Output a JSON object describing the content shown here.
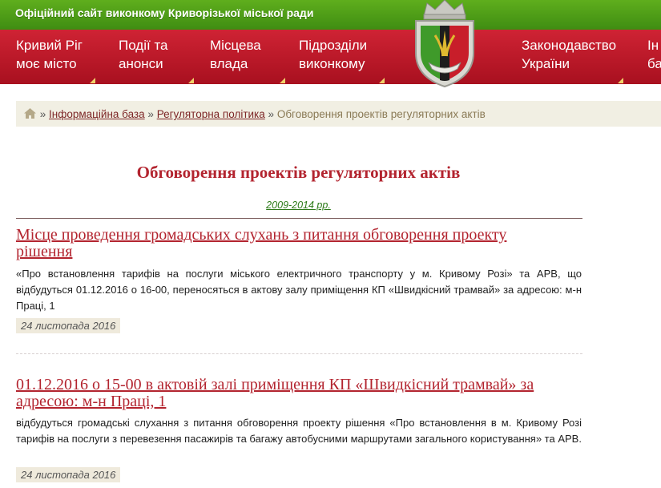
{
  "header": {
    "site_title": "Офіційний сайт виконкому Криворізької міської ради"
  },
  "nav": {
    "items": [
      {
        "line1": "Кривий Ріг",
        "line2": "моє місто"
      },
      {
        "line1": "Події та",
        "line2": "анонси"
      },
      {
        "line1": "Місцева",
        "line2": "влада"
      },
      {
        "line1": "Підрозділи",
        "line2": "виконкому"
      },
      {
        "line1": "Законодавство",
        "line2": "України"
      },
      {
        "line1": "Ін",
        "line2": "ба"
      }
    ],
    "emblem": "city-coat-of-arms",
    "colors": {
      "top_bar": "#4f9e18",
      "nav_bar": "#c01a2a",
      "accent_corner": "#f0d36a"
    }
  },
  "breadcrumb": {
    "home_icon": "home-icon",
    "separator": "»",
    "items": [
      {
        "label": "Інформаційна база"
      },
      {
        "label": "Регуляторна політика"
      }
    ],
    "current": "Обговорення проектів регуляторних актів"
  },
  "main": {
    "title": "Обговорення проектів регуляторних актів",
    "years_link": "2009-2014 рр.",
    "news": [
      {
        "title_line1": "Місце проведення громадських слухань з питання обговорення проекту",
        "title_line2": "рішення",
        "body": "«Про встановлення тарифів на послуги міського електричного транспорту у м. Кривому Розі» та АРВ, що відбудуться 01.12.2016 о 16-00, переносяться в актову залу приміщення КП «Швидкісний трамвай» за адресою: м-н Праці, 1",
        "date": "24 листопада 2016"
      },
      {
        "title_line1": "01.12.2016 о 15-00 в актовій залі приміщення КП «Швидкісний трамвай» за",
        "title_line2": "адресою: м-н Праці, 1",
        "body": "відбудуться громадські слухання з питання обговорення проекту рішення «Про встановлення в м. Кривому Розі тарифів на послуги з перевезення пасажирів та багажу автобусними маршрутами загального користування» та АРВ.",
        "date": "24 листопада 2016"
      }
    ]
  }
}
